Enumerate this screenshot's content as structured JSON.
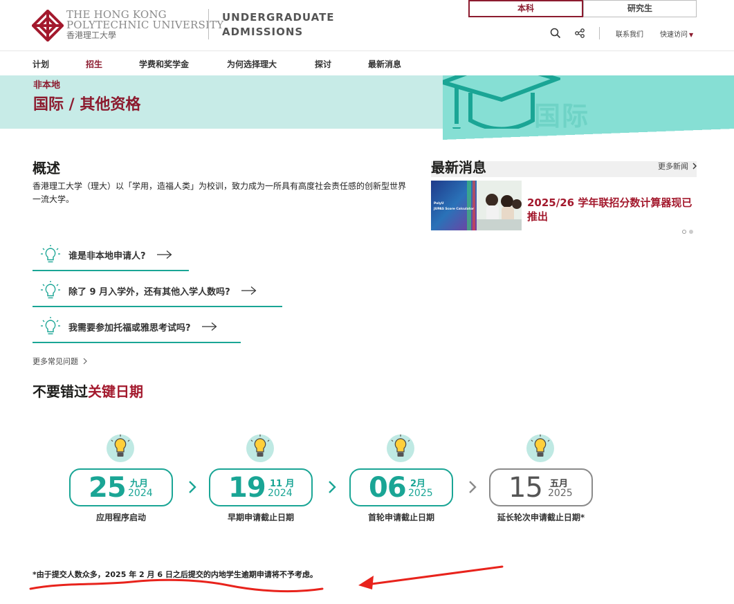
{
  "header": {
    "logo_en_line1": "THE HONG KONG",
    "logo_en_line2": "POLYTECHNIC UNIVERSITY",
    "logo_zh": "香港理工大學",
    "ug_line1": "UNDERGRADUATE",
    "ug_line2": "ADMISSIONS",
    "tabs": [
      {
        "label": "本科",
        "active": true
      },
      {
        "label": "研究生",
        "active": false
      }
    ],
    "contact_label": "联系我们",
    "quick_access_label": "快速访问"
  },
  "nav": {
    "items": [
      {
        "label": "计划",
        "active": false
      },
      {
        "label": "招生",
        "active": true
      },
      {
        "label": "学费和奖学金",
        "active": false
      },
      {
        "label": "为何选择理大",
        "active": false
      },
      {
        "label": "探讨",
        "active": false
      },
      {
        "label": "最新消息",
        "active": false
      }
    ]
  },
  "banner": {
    "subtitle": "非本地",
    "title": "国际 / 其他资格",
    "watermark": "国际"
  },
  "overview": {
    "heading": "概述",
    "text": "香港理工大学（理大）以「学用，造福人类」为校训，致力成为一所具有高度社会责任感的创新型世界一流大学。"
  },
  "faq": {
    "items": [
      {
        "label": "谁是非本地申请人?"
      },
      {
        "label": "除了 9 月入学外，还有其他入学人数吗?"
      },
      {
        "label": "我需要参加托福或雅思考试吗?"
      }
    ],
    "more_label": "更多常见问题"
  },
  "news": {
    "heading": "最新消息",
    "more_label": "更多新闻",
    "image_caption_line1": "PolyU",
    "image_caption_line2": "JUPAS Score Calculator",
    "headline": "2025/26 学年联招分数计算器现已推出"
  },
  "key_dates": {
    "title_prefix": "不要错过",
    "title_accent": "关键日期",
    "items": [
      {
        "day": "25",
        "month": "九月",
        "year": "2024",
        "label": "应用程序启动",
        "style": "teal"
      },
      {
        "day": "19",
        "month": "11 月",
        "year": "2024",
        "label": "早期申请截止日期",
        "style": "teal"
      },
      {
        "day": "06",
        "month": "2月",
        "year": "2025",
        "label": "首轮申请截止日期",
        "style": "teal"
      },
      {
        "day": "15",
        "month": "五月",
        "year": "2025",
        "label": "延长轮次申请截止日期*",
        "style": "grey"
      }
    ]
  },
  "footnote": "*由于提交人数众多，2025 年 2 月 6 日之后提交的内地学生逾期申请将不予考虑。",
  "colors": {
    "brand": "#8c1b2f",
    "teal": "#1aa595",
    "banner_light": "#c7ebe7",
    "banner_dark": "#86dfd4",
    "annotation": "#e8231c"
  }
}
